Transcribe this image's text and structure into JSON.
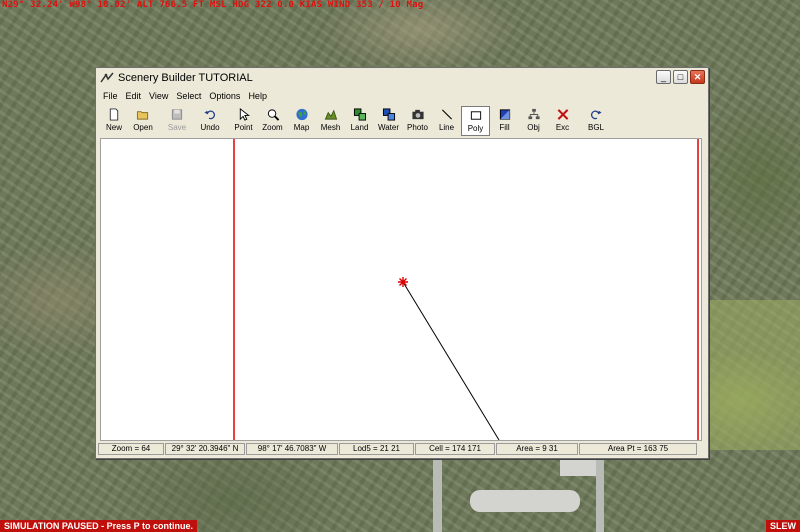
{
  "hud": {
    "top": "N29° 32.24'  W98° 18.02'  ALT 766.5 FT  MSL  HDG 322   0.0 KIAS  WIND 353 / 10 Mag",
    "paused": "SIMULATION PAUSED - Press P to continue.",
    "slew": "SLEW"
  },
  "window": {
    "title": "Scenery Builder  TUTORIAL",
    "controls": {
      "minimize": "_",
      "maximize": "□",
      "close": "✕"
    }
  },
  "menu": [
    "File",
    "Edit",
    "View",
    "Select",
    "Options",
    "Help"
  ],
  "toolbar": {
    "new": "New",
    "open": "Open",
    "save": "Save",
    "undo": "Undo",
    "point": "Point",
    "zoom": "Zoom",
    "map": "Map",
    "mesh": "Mesh",
    "land": "Land",
    "water": "Water",
    "photo": "Photo",
    "line": "Line",
    "poly": "Poly",
    "fill": "Fill",
    "obj": "Obj",
    "exc": "Exc",
    "bgl": "BGL"
  },
  "status": {
    "zoom": "Zoom = 64",
    "lat": "29° 32' 20.3946\" N",
    "lon": "98° 17' 46.7083\" W",
    "lod": "Lod5 = 21 21",
    "cell": "Cell = 174 171",
    "area": "Area = 9 31",
    "area_pt": "Area Pt = 163 75"
  },
  "colors": {
    "boundary": "#e00000",
    "marker": "#e00000",
    "line": "#000000",
    "hud_text": "#e0100e",
    "hud_bar": "#c0100c"
  },
  "icons": {
    "new": "new-document-icon",
    "open": "open-folder-icon",
    "save": "floppy-icon",
    "undo": "undo-arrow-icon",
    "point": "cursor-arrow-icon",
    "zoom": "magnifier-icon",
    "map": "globe-icon",
    "mesh": "mountain-icon",
    "land": "green-squares-icon",
    "water": "blue-squares-icon",
    "photo": "camera-icon",
    "line": "diagonal-line-icon",
    "poly": "rectangle-icon",
    "fill": "filled-square-icon",
    "obj": "network-nodes-icon",
    "exc": "red-x-icon",
    "bgl": "redo-arrow-icon"
  }
}
